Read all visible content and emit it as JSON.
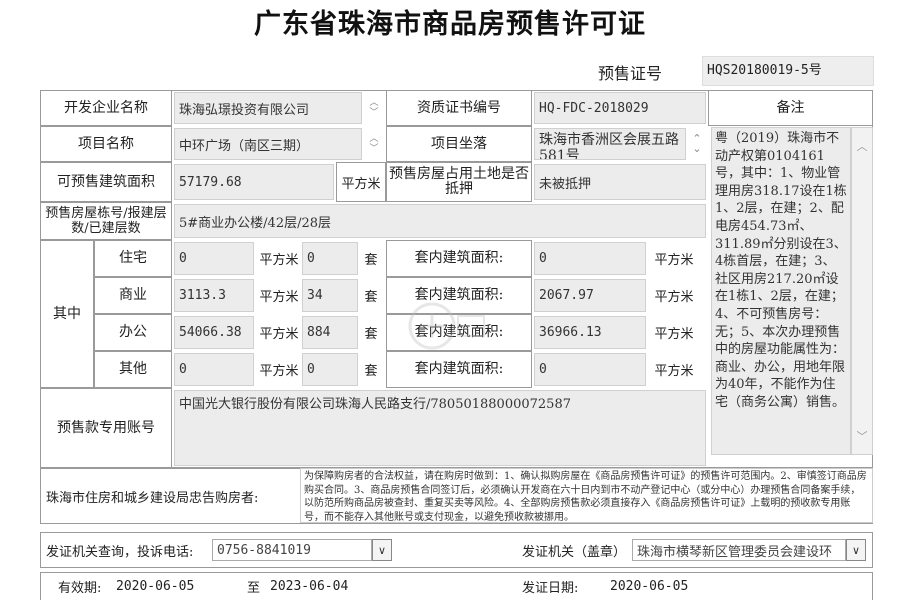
{
  "title": "广东省珠海市商品房预售许可证",
  "cert": {
    "label": "预售证号",
    "value": "HQS20180019-5号"
  },
  "row1": {
    "developer_label": "开发企业名称",
    "developer_value": "珠海弘璟投资有限公司",
    "qual_label": "资质证书编号",
    "qual_value": "HQ-FDC-2018029",
    "notes_label": "备注"
  },
  "row2": {
    "project_label": "项目名称",
    "project_value": "中环广场（南区三期）",
    "location_label": "项目坐落",
    "location_value": "珠海市香洲区会展五路 581号"
  },
  "row3": {
    "area_label": "可预售建筑面积",
    "area_value": "57179.68",
    "area_unit": "平方米",
    "land_label": "预售房屋占用土地是否抵押",
    "land_value": "未被抵押"
  },
  "row4": {
    "building_label": "预售房屋栋号/报建层数/已建层数",
    "building_value": "5#商业办公楼/42层/28层"
  },
  "breakdown": {
    "group_label": "其中",
    "area_unit": "平方米",
    "count_unit": "套",
    "inner_label": "套内建筑面积:",
    "inner_unit": "平方米",
    "rows": [
      {
        "label": "住宅",
        "area": "0",
        "count": "0",
        "inner": "0"
      },
      {
        "label": "商业",
        "area": "3113.3",
        "count": "34",
        "inner": "2067.97"
      },
      {
        "label": "办公",
        "area": "54066.38",
        "count": "884",
        "inner": "36966.13"
      },
      {
        "label": "其他",
        "area": "0",
        "count": "0",
        "inner": "0"
      }
    ]
  },
  "account": {
    "label": "预售款专用账号",
    "value": "中国光大银行股份有限公司珠海人民路支行/78050188000072587"
  },
  "notes": "粤（2019）珠海市不动产权第0104161号，其中：1、物业管理用房318.17设在1栋1、2层，在建；2、配电房454.73㎡、311.89㎡分别设在3、4栋首层，在建；3、社区用房217.20㎡设在1栋1、2层，在建；4、不可预售房号：无；5、本次办理预售中的房屋功能属性为：商业、办公，用地年限为40年，不能作为住宅（商务公寓）销售。",
  "notice": {
    "label": "珠海市住房和城乡建设局忠告购房者:",
    "text": "为保障购房者的合法权益，请在购房时做到：1、确认拟购房屋在《商品房预售许可证》的预售许可范围内。2、审慎签订商品房购买合同。3、商品房预售合同签订后，必须确认开发商在六十日内到市不动产登记中心（或分中心）办理预售合同备案手续，以防范所购商品房被查封、重复买卖等风险。4、全部购房预售款必须直接存入《商品房预售许可证》上载明的预收款专用账号，而不能存入其他账号或支付现金，以避免预收款被挪用。"
  },
  "footer": {
    "phone_label": "发证机关查询，投诉电话:",
    "phone_value": "0756-8841019",
    "issuer_label": "发证机关（盖章）",
    "issuer_value": "珠海市横琴新区管理委员会建设环",
    "valid_label": "有效期:",
    "valid_from": "2020-06-05",
    "to_label": "至",
    "valid_to": "2023-06-04",
    "issue_label": "发证日期:",
    "issue_date": "2020-06-05"
  },
  "colors": {
    "label_cell": "#ffffff",
    "field_bg": "#ececec",
    "border": "#9a9a9a"
  },
  "icons": [
    "spin-arrows-icon",
    "dropdown-arrow-icon",
    "scroll-arrow-icon",
    "watermark-logo-icon"
  ]
}
